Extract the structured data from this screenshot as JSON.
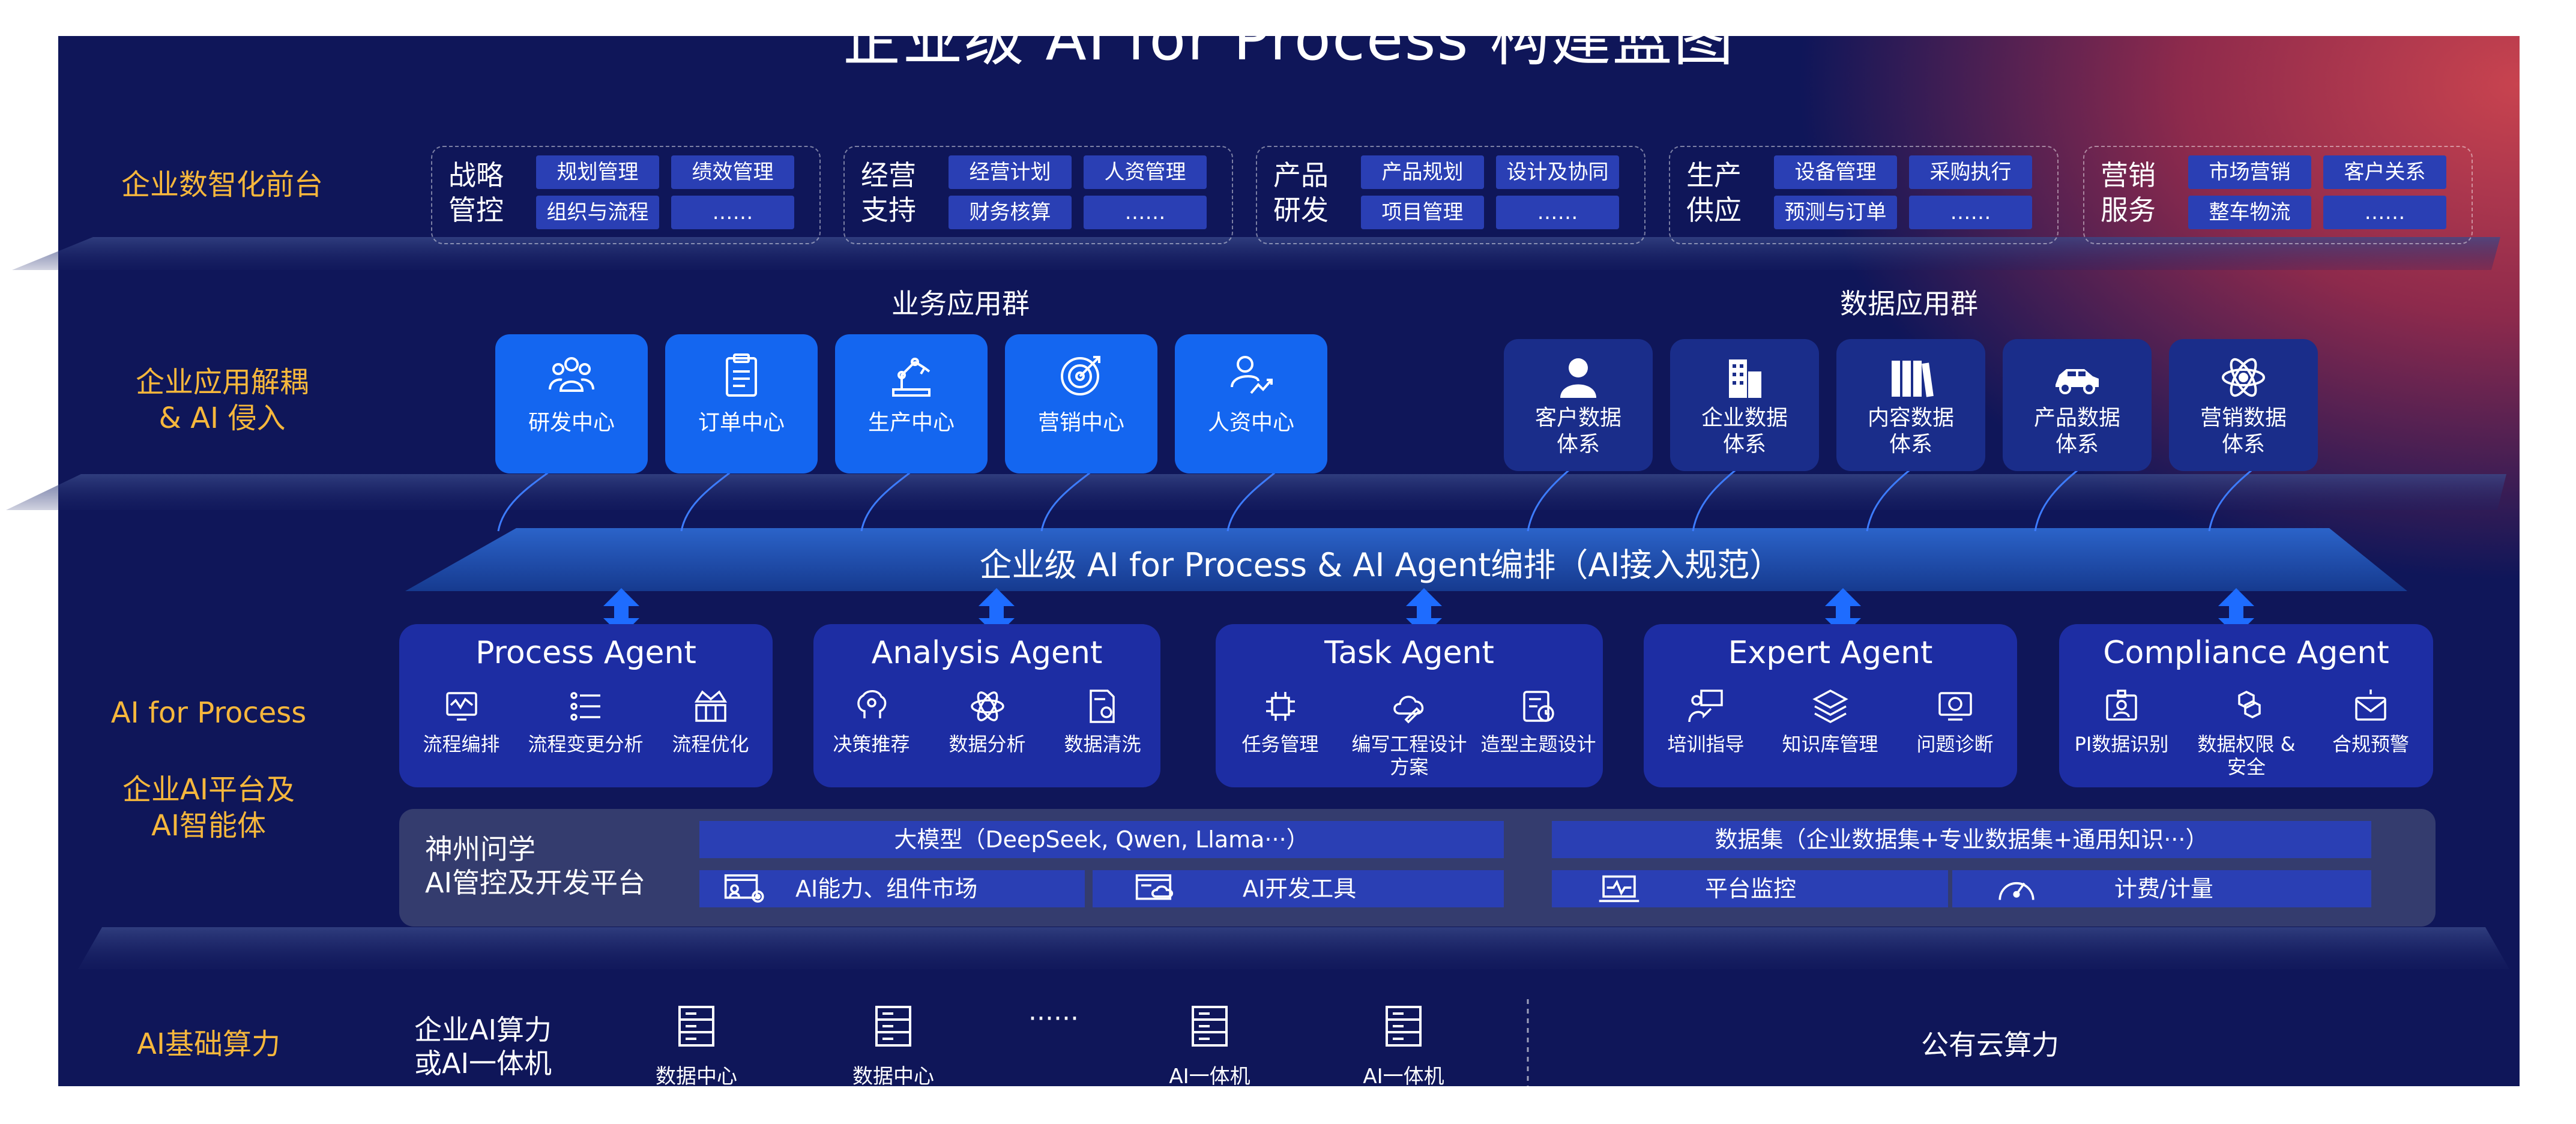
{
  "title": "企业级 AI for Process 构建蓝图",
  "rows": {
    "front": "企业数智化前台",
    "apps_line1": "企业应用解耦",
    "apps_line2": "& AI 侵入",
    "ai_process": "AI for Process",
    "platform_line1": "企业AI平台及",
    "platform_line2": "AI智能体",
    "compute": "AI基础算力"
  },
  "front_categories": [
    {
      "title_line1": "战略",
      "title_line2": "管控",
      "items": [
        "规划管理",
        "绩效管理",
        "组织与流程",
        "……"
      ]
    },
    {
      "title_line1": "经营",
      "title_line2": "支持",
      "items": [
        "经营计划",
        "人资管理",
        "财务核算",
        "……"
      ]
    },
    {
      "title_line1": "产品",
      "title_line2": "研发",
      "items": [
        "产品规划",
        "设计及协同",
        "项目管理",
        "……"
      ]
    },
    {
      "title_line1": "生产",
      "title_line2": "供应",
      "items": [
        "设备管理",
        "采购执行",
        "预测与订单",
        "……"
      ]
    },
    {
      "title_line1": "营销",
      "title_line2": "服务",
      "items": [
        "市场营销",
        "客户关系",
        "整车物流",
        "……"
      ]
    }
  ],
  "business_apps": {
    "title": "业务应用群",
    "items": [
      {
        "label": "研发中心",
        "icon": "team-icon"
      },
      {
        "label": "订单中心",
        "icon": "clipboard-icon"
      },
      {
        "label": "生产中心",
        "icon": "robot-arm-icon"
      },
      {
        "label": "营销中心",
        "icon": "target-icon"
      },
      {
        "label": "人资中心",
        "icon": "people-chart-icon"
      }
    ]
  },
  "data_apps": {
    "title": "数据应用群",
    "items": [
      {
        "line1": "客户数据",
        "line2": "体系",
        "icon": "person-icon"
      },
      {
        "line1": "企业数据",
        "line2": "体系",
        "icon": "building-icon"
      },
      {
        "line1": "内容数据",
        "line2": "体系",
        "icon": "books-icon"
      },
      {
        "line1": "产品数据",
        "line2": "体系",
        "icon": "car-icon"
      },
      {
        "line1": "营销数据",
        "line2": "体系",
        "icon": "atom-icon"
      }
    ]
  },
  "orchestration": "企业级 AI for Process & AI Agent编排（AI接入规范）",
  "agents": [
    {
      "name": "Process Agent",
      "subs": [
        {
          "line1": "流程编排",
          "line2": "",
          "icon": "monitor-wave-icon"
        },
        {
          "line1": "流程变更分析",
          "line2": "",
          "icon": "list-icon"
        },
        {
          "line1": "流程优化",
          "line2": "",
          "icon": "crown-grid-icon"
        }
      ]
    },
    {
      "name": "Analysis Agent",
      "subs": [
        {
          "line1": "决策推荐",
          "line2": "",
          "icon": "brain-icon"
        },
        {
          "line1": "数据分析",
          "line2": "",
          "icon": "atom-icon"
        },
        {
          "line1": "数据清洗",
          "line2": "",
          "icon": "doc-gear-icon"
        }
      ]
    },
    {
      "name": "Task Agent",
      "subs": [
        {
          "line1": "任务管理",
          "line2": "",
          "icon": "chip-icon"
        },
        {
          "line1": "编写工程设计方案",
          "line2": "",
          "icon": "cloud-pen-icon"
        },
        {
          "line1": "造型主题设计",
          "line2": "",
          "icon": "checklist-clock-icon"
        }
      ]
    },
    {
      "name": "Expert Agent",
      "subs": [
        {
          "line1": "培训指导",
          "line2": "",
          "icon": "teacher-icon"
        },
        {
          "line1": "知识库管理",
          "line2": "",
          "icon": "layers-icon"
        },
        {
          "line1": "问题诊断",
          "line2": "",
          "icon": "diagnosis-icon"
        }
      ]
    },
    {
      "name": "Compliance Agent",
      "subs": [
        {
          "line1": "PI数据识别",
          "line2": "",
          "icon": "id-card-icon"
        },
        {
          "line1": "数据权限 &",
          "line2": "安全",
          "icon": "hexagons-icon"
        },
        {
          "line1": "合规预警",
          "line2": "",
          "icon": "mail-alert-icon"
        }
      ]
    }
  ],
  "platform": {
    "label_line1": "神州问学",
    "label_line2": "AI管控及开发平台",
    "model": "大模型（DeepSeek, Qwen, Llama···）",
    "dataset": "数据集（企业数据集+专业数据集+通用知识···）",
    "tools": [
      {
        "label": "AI能力、组件市场",
        "icon": "screen-gear-icon"
      },
      {
        "label": "AI开发工具",
        "icon": "screen-cloud-icon"
      },
      {
        "label": "平台监控",
        "icon": "laptop-pulse-icon"
      },
      {
        "label": "计费/计量",
        "icon": "gauge-icon"
      }
    ]
  },
  "compute": {
    "label_line1": "企业AI算力",
    "label_line2": "或AI一体机",
    "items": [
      {
        "label": "数据中心",
        "icon": "server-icon"
      },
      {
        "label": "数据中心",
        "icon": "server-icon"
      },
      {
        "label": "AI一体机",
        "icon": "server-icon"
      },
      {
        "label": "AI一体机",
        "icon": "server-icon"
      }
    ],
    "ellipsis": "······",
    "public_cloud": "公有云算力"
  }
}
